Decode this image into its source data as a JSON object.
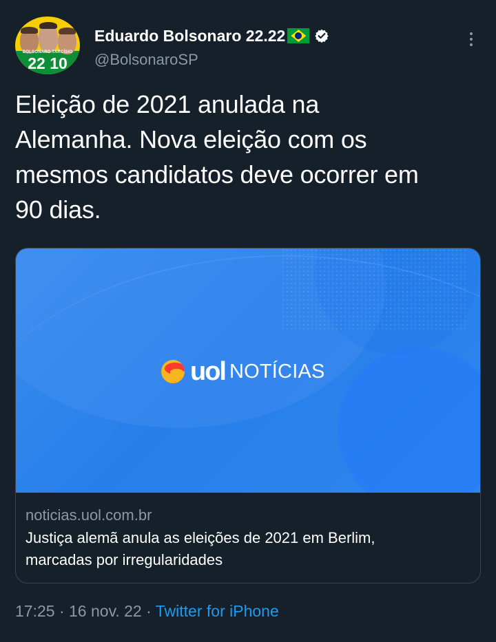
{
  "author": {
    "display_name": "Eduardo Bolsonaro 22.22",
    "handle": "@BolsonaroSP",
    "avatar_text_left": "BOLSONARO",
    "avatar_text_right": "TARCÍSIO",
    "avatar_numbers": "22 10",
    "flag_icon": "brazil-flag-icon",
    "verified_icon": "verified-badge-icon"
  },
  "tweet": {
    "text": "Eleição de 2021 anulada na\nAlemanha. Nova eleição com os\nmesmos candidatos deve ocorrer em\n90 dias."
  },
  "link_card": {
    "image_brand": "uol",
    "image_section": "NOTÍCIAS",
    "domain": "noticias.uol.com.br",
    "title": "Justiça alemã anula as eleições de 2021 em Berlim,\nmarcadas por irregularidades"
  },
  "metadata": {
    "time": "17:25",
    "separator_1": " · ",
    "date": "16 nov. 22",
    "separator_2": " · ",
    "source": "Twitter for iPhone"
  },
  "colors": {
    "background": "#15202b",
    "text_primary": "#ffffff",
    "text_secondary": "#8b98a5",
    "link": "#1d9bf0",
    "card_border": "#38444d",
    "card_image_blue": "#277fea"
  },
  "icons": {
    "more_options": "more-options-icon"
  }
}
